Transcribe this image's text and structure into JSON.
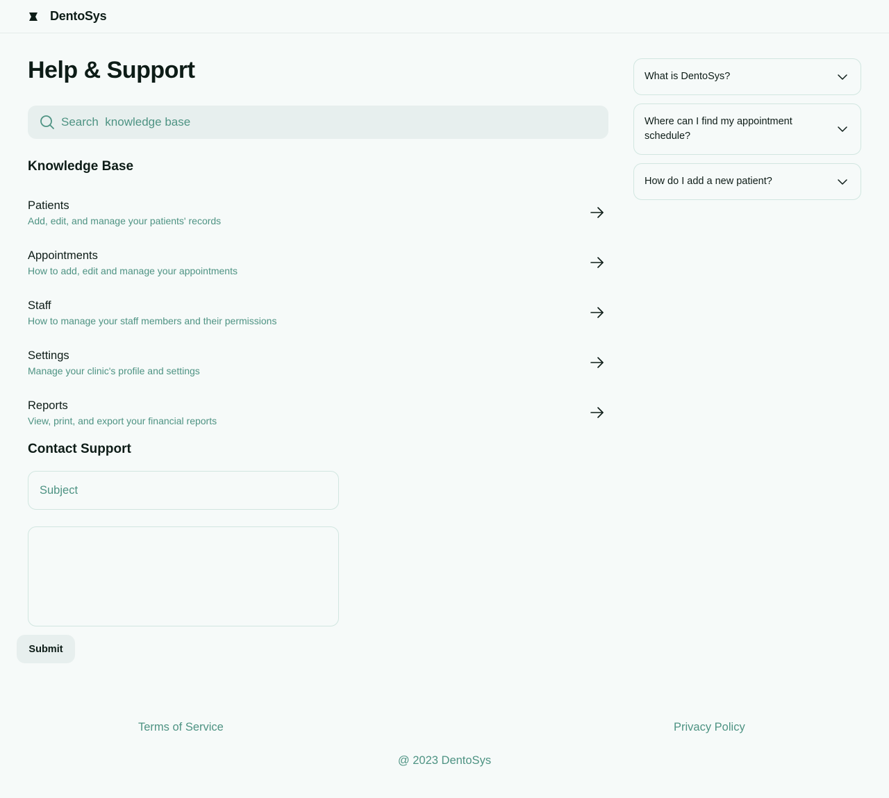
{
  "app": {
    "brand": "DentoSys",
    "logo_icon": "bookmark-icon"
  },
  "colors": {
    "background": "#f6faf9",
    "text_primary": "#0d1c17",
    "text_secondary": "#4e9383",
    "surface": "#e7efee",
    "border": "#d1e6e0"
  },
  "page": {
    "title": "Help & Support"
  },
  "search": {
    "placeholder": "Search  knowledge base",
    "icon": "search-icon"
  },
  "knowledge_base": {
    "heading": "Knowledge Base",
    "items": [
      {
        "title": "Patients",
        "description": "Add, edit, and manage your patients' records",
        "icon": "arrow-right-icon"
      },
      {
        "title": "Appointments",
        "description": "How to add, edit and manage your appointments",
        "icon": "arrow-right-icon"
      },
      {
        "title": "Staff",
        "description": "How to manage your staff members and their permissions",
        "icon": "arrow-right-icon"
      },
      {
        "title": "Settings",
        "description": "Manage your clinic's profile and settings",
        "icon": "arrow-right-icon"
      },
      {
        "title": "Reports",
        "description": "View, print, and export your financial reports",
        "icon": "arrow-right-icon"
      }
    ]
  },
  "contact": {
    "heading": "Contact Support",
    "subject_placeholder": "Subject",
    "message_value": "",
    "submit_label": "Submit"
  },
  "faq": [
    {
      "question": "What is DentoSys?",
      "icon": "chevron-down-icon"
    },
    {
      "question": "Where can I find my appointment schedule?",
      "icon": "chevron-down-icon"
    },
    {
      "question": "How do I add a new patient?",
      "icon": "chevron-down-icon"
    }
  ],
  "footer": {
    "terms": "Terms of Service",
    "privacy": "Privacy Policy",
    "copyright": "@ 2023 DentoSys"
  }
}
